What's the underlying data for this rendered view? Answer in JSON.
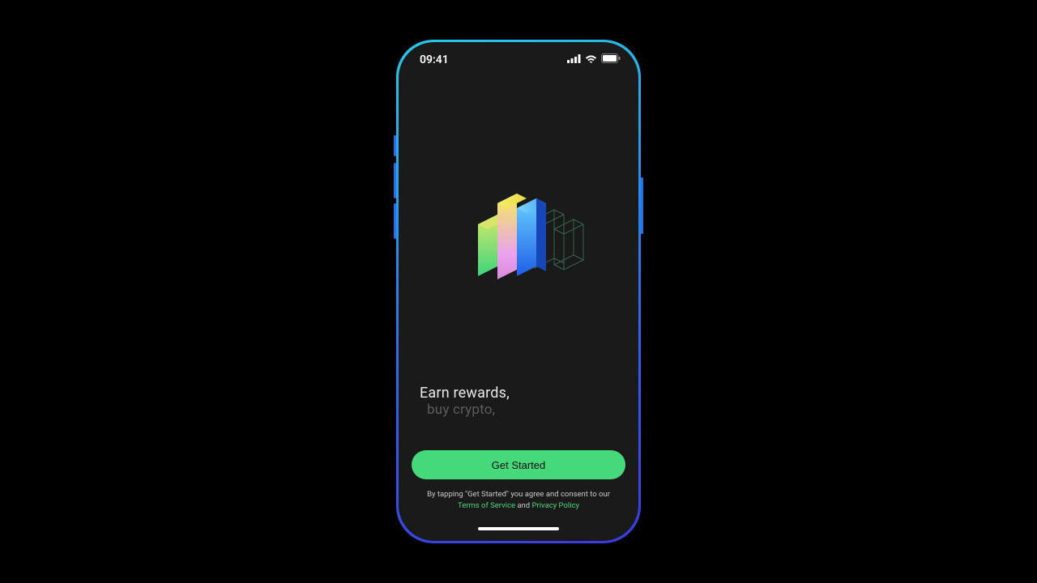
{
  "status": {
    "time": "09:41"
  },
  "tagline": {
    "line1": "Earn rewards,",
    "line2": "buy crypto,"
  },
  "cta": {
    "label": "Get Started"
  },
  "legal": {
    "prefix": "By tapping \"Get Started\" you agree and consent to our",
    "tos": "Terms of Service",
    "and": " and ",
    "privacy": "Privacy Policy"
  }
}
